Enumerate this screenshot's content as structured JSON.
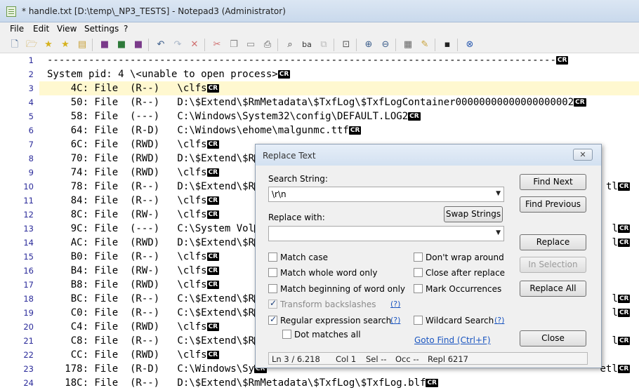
{
  "window": {
    "title": "* handle.txt [D:\\temp\\_NP3_TESTS] - Notepad3 (Administrator)"
  },
  "menu": [
    "File",
    "Edit",
    "View",
    "Settings",
    "?"
  ],
  "toolbar_icons": [
    "new-icon",
    "open-icon",
    "favorites-icon",
    "add-favorite-icon",
    "browse-icon",
    "save-icon",
    "save-as-icon",
    "save-copy-icon",
    "undo-icon",
    "redo-icon",
    "delete-icon",
    "cut-icon",
    "copy-icon",
    "paste-icon",
    "print-icon",
    "find-icon",
    "replace-icon",
    "select-icon",
    "goto-icon",
    "zoom-in-icon",
    "zoom-out-icon",
    "schemes-icon",
    "customize-icon",
    "screen-icon",
    "exit-icon"
  ],
  "editor": {
    "lines": [
      {
        "n": "1",
        "t": "--------------------------------------------------------------------------------------"
      },
      {
        "n": "2",
        "t": "System pid: 4 \\<unable to open process>"
      },
      {
        "n": "3",
        "t": "    4C: File  (R--)   \\clfs"
      },
      {
        "n": "4",
        "t": "    50: File  (R--)   D:\\$Extend\\$RmMetadata\\$TxfLog\\$TxfLogContainer00000000000000000002"
      },
      {
        "n": "5",
        "t": "    58: File  (---)   C:\\Windows\\System32\\config\\DEFAULT.LOG2"
      },
      {
        "n": "6",
        "t": "    64: File  (R-D)   C:\\Windows\\ehome\\malgunmc.ttf"
      },
      {
        "n": "7",
        "t": "    6C: File  (RWD)   \\clfs"
      },
      {
        "n": "8",
        "t": "    70: File  (RWD)   D:\\$Extend\\$R"
      },
      {
        "n": "9",
        "t": "    74: File  (RWD)   \\clfs"
      },
      {
        "n": "10",
        "t": "    78: File  (R--)   D:\\$Extend\\$R"
      },
      {
        "n": "11",
        "t": "    84: File  (R--)   \\clfs"
      },
      {
        "n": "12",
        "t": "    8C: File  (RW-)   \\clfs"
      },
      {
        "n": "13",
        "t": "    9C: File  (---)   C:\\System Vol"
      },
      {
        "n": "14",
        "t": "    AC: File  (RWD)   D:\\$Extend\\$R"
      },
      {
        "n": "15",
        "t": "    B0: File  (R--)   \\clfs"
      },
      {
        "n": "16",
        "t": "    B4: File  (RW-)   \\clfs"
      },
      {
        "n": "17",
        "t": "    B8: File  (RWD)   \\clfs"
      },
      {
        "n": "18",
        "t": "    BC: File  (R--)   C:\\$Extend\\$R"
      },
      {
        "n": "19",
        "t": "    C0: File  (R--)   C:\\$Extend\\$R"
      },
      {
        "n": "20",
        "t": "    C4: File  (RWD)   \\clfs"
      },
      {
        "n": "21",
        "t": "    C8: File  (R--)   C:\\$Extend\\$R"
      },
      {
        "n": "22",
        "t": "    CC: File  (RWD)   \\clfs"
      },
      {
        "n": "23",
        "t": "   178: File  (R-D)   C:\\Windows\\Sy"
      },
      {
        "n": "24",
        "t": "   18C: File  (R--)   D:\\$Extend\\$RmMetadata\\$TxfLog\\$TxfLog.blf"
      }
    ],
    "cr_label": "CR",
    "right_tails": {
      "10": "tl",
      "13": "l",
      "14": "l",
      "18": "l",
      "19": "l",
      "21": "l",
      "23": "etl"
    }
  },
  "dialog": {
    "title": "Replace Text",
    "close": "✕",
    "search_label": "Search String:",
    "search_value": "\\r\\n",
    "replace_label": "Replace with:",
    "replace_value": "",
    "swap": "Swap Strings",
    "find_next": "Find Next",
    "find_previous": "Find Previous",
    "replace": "Replace",
    "in_selection": "In Selection",
    "replace_all": "Replace All",
    "close_btn": "Close",
    "match_case": "Match case",
    "match_whole": "Match whole word only",
    "match_beginning": "Match beginning of word only",
    "transform_backslashes": "Transform backslashes",
    "regex": "Regular expression search",
    "dot_matches": "Dot matches all",
    "dont_wrap": "Don't wrap around",
    "close_after": "Close after replace",
    "mark_occurrences": "Mark Occurrences",
    "wildcard": "Wildcard Search",
    "help": "(?)",
    "goto_find": "Goto Find (Ctrl+F)",
    "status": {
      "ln": "Ln 3 / 6.218",
      "col": "Col 1",
      "sel": "Sel --",
      "occ": "Occ --",
      "repl": "Repl 6217"
    }
  }
}
